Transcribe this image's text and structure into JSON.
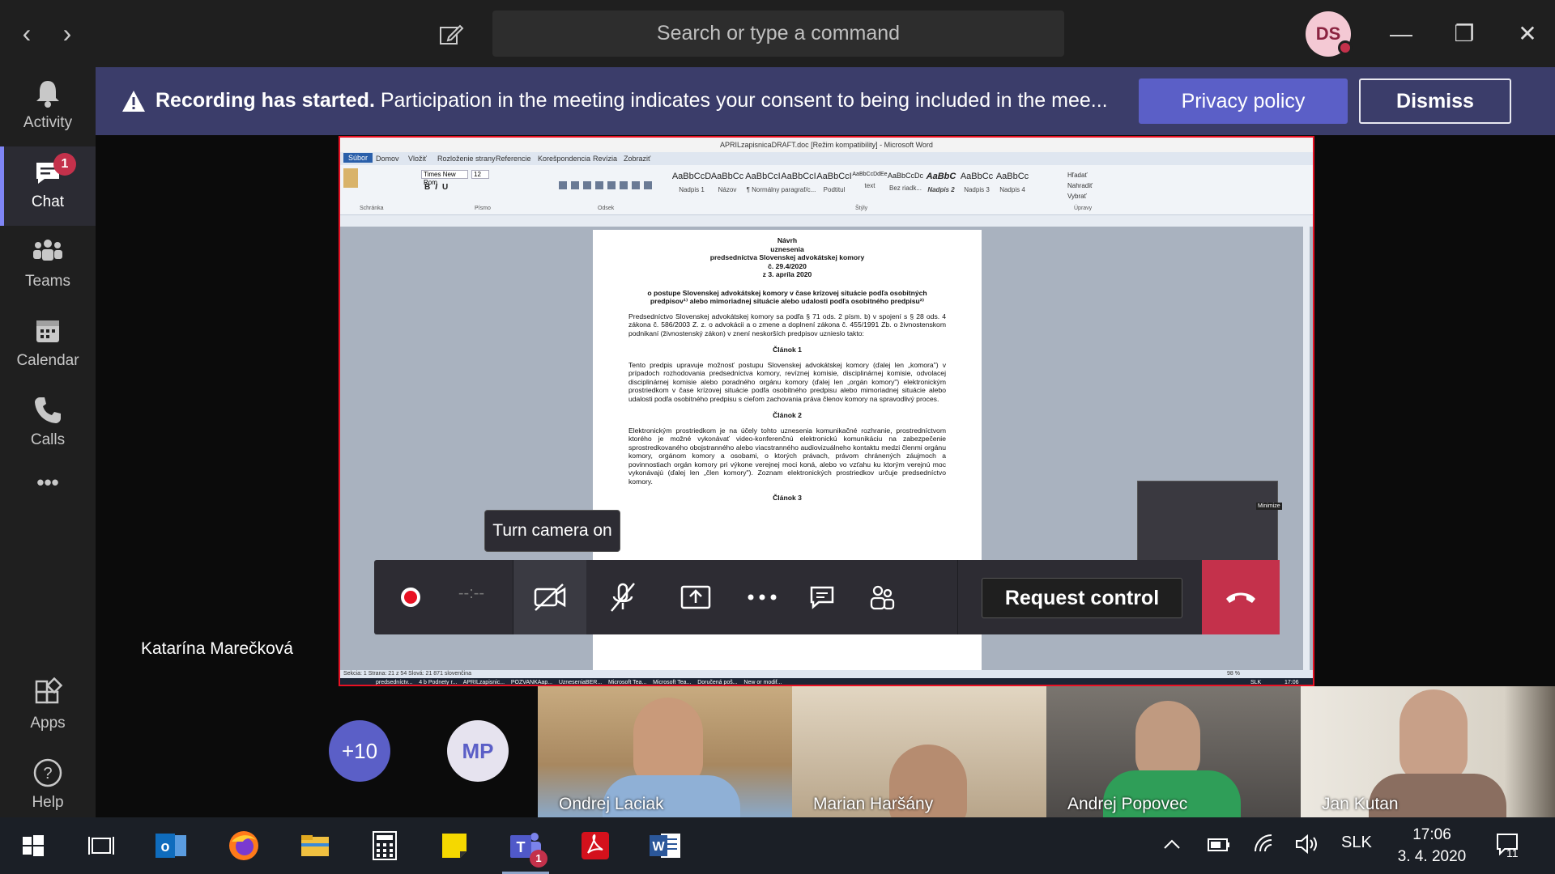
{
  "titlebar": {
    "back": "‹",
    "forward": "›",
    "search_placeholder": "Search or type a command",
    "user_initials": "DS",
    "minimize": "—",
    "maximize": "❐",
    "close": "✕"
  },
  "rail": {
    "items": [
      {
        "label": "Activity",
        "icon": "bell-icon"
      },
      {
        "label": "Chat",
        "icon": "chat-icon",
        "badge": "1",
        "active": true
      },
      {
        "label": "Teams",
        "icon": "teams-icon"
      },
      {
        "label": "Calendar",
        "icon": "calendar-icon"
      },
      {
        "label": "Calls",
        "icon": "phone-icon"
      },
      {
        "label": "•••",
        "icon": "more-icon"
      },
      {
        "label": "Apps",
        "icon": "apps-icon"
      },
      {
        "label": "Help",
        "icon": "help-icon"
      }
    ]
  },
  "banner": {
    "bold": "Recording has started.",
    "text": " Participation in the meeting indicates your consent to being included in the mee...",
    "privacy_label": "Privacy policy",
    "dismiss_label": "Dismiss"
  },
  "word": {
    "title": "APRILzapisnicaDRAFT.doc [Režim kompatibility] - Microsoft Word",
    "tabs": [
      "Súbor",
      "Domov",
      "Vložiť",
      "Rozloženie strany",
      "Referencie",
      "Korešpondencia",
      "Revízia",
      "Zobraziť"
    ],
    "font": "Times New Rom",
    "font_size": "12",
    "styles": [
      {
        "sample": "AaBbCcD",
        "name": "Nadpis 1"
      },
      {
        "sample": "AaBbCc",
        "name": "Názov"
      },
      {
        "sample": "AaBbCcI",
        "name": "¶ Normálny"
      },
      {
        "sample": "AaBbCcI",
        "name": "paragraf/c..."
      },
      {
        "sample": "AaBbCcI",
        "name": "Podtitul"
      },
      {
        "sample": "AaBbCcDdEe",
        "name": "text"
      },
      {
        "sample": "AaBbCcDc",
        "name": "Bez riadk..."
      },
      {
        "sample": "AaBbC",
        "name": "Nadpis 2"
      },
      {
        "sample": "AaBbCc",
        "name": "Nadpis 3"
      },
      {
        "sample": "AaBbCc",
        "name": "Nadpis 4"
      }
    ],
    "groups": [
      "Schránka",
      "Písmo",
      "Odsek",
      "Štýly",
      "Úpravy"
    ],
    "edit_items": [
      "Hľadať",
      "Nahradiť",
      "Vybrať"
    ],
    "doc": {
      "head": [
        "Návrh",
        "uznesenia",
        "predsedníctva Slovenskej advokátskej komory",
        "č. 29.4/2020",
        "z 3. apríla 2020"
      ],
      "subject": "o postupe Slovenskej advokátskej komory v čase krízovej situácie podľa osobitných predpisov¹⁾ alebo mimoriadnej situácie alebo udalosti podľa osobitného predpisu²⁾",
      "intro": "Predsedníctvo Slovenskej advokátskej komory sa podľa § 71 ods. 2 písm. b) v spojení s § 28 ods. 4 zákona č. 586/2003 Z. z. o advokácii a o zmene a doplnení zákona č. 455/1991 Zb. o živnostenskom podnikaní (živnostenský zákon) v znení neskorších predpisov uznieslo takto:",
      "art1": "Článok 1",
      "art1_text": "Tento predpis upravuje možnosť postupu Slovenskej advokátskej komory (ďalej len „komora\") v prípadoch rozhodovania predsedníctva komory, revíznej komisie, disciplinárnej komisie, odvolacej disciplinárnej komisie alebo poradného orgánu komory (ďalej len „orgán komory\") elektronickým prostriedkom v čase krízovej situácie podľa osobitného predpisu alebo mimoriadnej situácie alebo udalosti podľa osobitného predpisu s cieľom zachovania práva členov komory na spravodlivý proces.",
      "art2": "Článok 2",
      "art2_text": "Elektronickým prostriedkom je na účely tohto uznesenia komunikačné rozhranie, prostredníctvom ktorého je možné vykonávať video-konferenčnú elektronickú komunikáciu na zabezpečenie sprostredkovaného obojstranného alebo viacstranného audiovizuálneho kontaktu medzi členmi orgánu komory, orgánom komory a osobami, o ktorých právach, právom chránených záujmoch a povinnostiach orgán komory pri výkone verejnej moci koná, alebo vo vzťahu ku ktorým verejnú moc vykonávajú (ďalej len „člen komory\"). Zoznam elektronických prostriedkov určuje predsedníctvo komory.",
      "art3": "Článok 3"
    },
    "status": "Sekcia: 1    Strana: 21 z 54    Slová: 21 871    slovenčina",
    "zoom": "98 %",
    "minimize_tip": "Minimize",
    "remote_tasks": [
      "predsedníctv...",
      "4 b Podnety r...",
      "APRILzapisnic...",
      "POZVANKAap...",
      "UzneseniaBER...",
      "Microsoft Tea...",
      "Microsoft Tea...",
      "Doručená poš...",
      "New or modif..."
    ],
    "remote_lang": "SLK",
    "remote_time": "17:06"
  },
  "presenter_name": "Katarína Marečková",
  "meeting_bar": {
    "timer": "--:--",
    "tooltip": "Turn camera on",
    "request_control": "Request control"
  },
  "participants": {
    "overflow": "+10",
    "mp_initials": "MP",
    "tiles": [
      {
        "name": "Ondrej Laciak",
        "bg": "#b89a74"
      },
      {
        "name": "Marian Haršány",
        "bg": "#c9b69b"
      },
      {
        "name": "Andrej Popovec",
        "bg": "#6a6560"
      },
      {
        "name": "Jan Kutan",
        "bg": "#d8d4cc"
      }
    ]
  },
  "taskbar": {
    "lang": "SLK",
    "time": "17:06",
    "date": "3. 4. 2020",
    "notifications": "11",
    "teams_badge": "1"
  },
  "colors": {
    "accent": "#5b5fc7",
    "banner": "#3b3d6a",
    "hangup": "#c4314b",
    "recording_red": "#e81123"
  }
}
